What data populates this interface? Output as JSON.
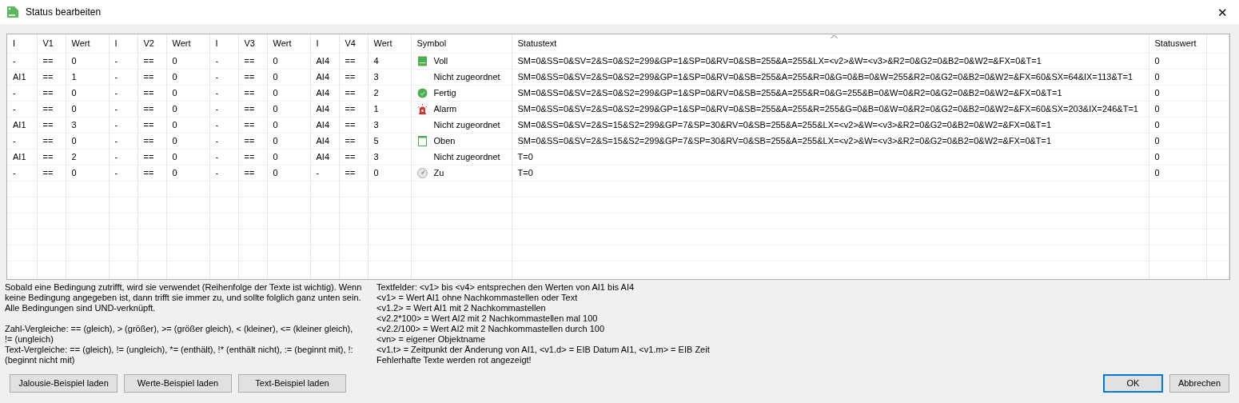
{
  "window": {
    "title": "Status bearbeiten",
    "close": "✕"
  },
  "table": {
    "columns": [
      {
        "label": "I",
        "sorted": false
      },
      {
        "label": "V1",
        "sorted": false
      },
      {
        "label": "Wert",
        "sorted": false
      },
      {
        "label": "I",
        "sorted": false
      },
      {
        "label": "V2",
        "sorted": false
      },
      {
        "label": "Wert",
        "sorted": false
      },
      {
        "label": "I",
        "sorted": false
      },
      {
        "label": "V3",
        "sorted": false
      },
      {
        "label": "Wert",
        "sorted": false
      },
      {
        "label": "I",
        "sorted": false
      },
      {
        "label": "V4",
        "sorted": false
      },
      {
        "label": "Wert",
        "sorted": false
      },
      {
        "label": "Symbol",
        "sorted": false
      },
      {
        "label": "Statustext",
        "sorted": true
      },
      {
        "label": "Statuswert",
        "sorted": false
      }
    ],
    "rows": [
      {
        "cells": [
          "-",
          "==",
          "0",
          "-",
          "==",
          "0",
          "-",
          "==",
          "0",
          "AI4",
          "==",
          "4"
        ],
        "symbol": {
          "kind": "panel-filled",
          "label": "Voll"
        },
        "statustext": "SM=0&SS=0&SV=2&S=0&S2=299&GP=1&SP=0&RV=0&SB=255&A=255&LX=<v2>&W=<v3>&R2=0&G2=0&B2=0&W2=&FX=0&T=1",
        "statuswert": "0"
      },
      {
        "cells": [
          "AI1",
          "==",
          "1",
          "-",
          "==",
          "0",
          "-",
          "==",
          "0",
          "AI4",
          "==",
          "3"
        ],
        "symbol": {
          "kind": "none",
          "label": "Nicht zugeordnet"
        },
        "statustext": "SM=0&SS=0&SV=2&S=0&S2=299&GP=1&SP=0&RV=0&SB=255&A=255&R=0&G=0&B=0&W=255&R2=0&G2=0&B2=0&W2=&FX=60&SX=64&IX=113&T=1",
        "statuswert": "0"
      },
      {
        "cells": [
          "-",
          "==",
          "0",
          "-",
          "==",
          "0",
          "-",
          "==",
          "0",
          "AI4",
          "==",
          "2"
        ],
        "symbol": {
          "kind": "check",
          "label": "Fertig"
        },
        "statustext": "SM=0&SS=0&SV=2&S=0&S2=299&GP=1&SP=0&RV=0&SB=255&A=255&R=0&G=255&B=0&W=0&R2=0&G2=0&B2=0&W2=&FX=0&T=1",
        "statuswert": "0"
      },
      {
        "cells": [
          "-",
          "==",
          "0",
          "-",
          "==",
          "0",
          "-",
          "==",
          "0",
          "AI4",
          "==",
          "1"
        ],
        "symbol": {
          "kind": "alarm",
          "label": "Alarm"
        },
        "statustext": "SM=0&SS=0&SV=2&S=0&S2=299&GP=1&SP=0&RV=0&SB=255&A=255&R=255&G=0&B=0&W=0&R2=0&G2=0&B2=0&W2=&FX=60&SX=203&IX=246&T=1",
        "statuswert": "0"
      },
      {
        "cells": [
          "AI1",
          "==",
          "3",
          "-",
          "==",
          "0",
          "-",
          "==",
          "0",
          "AI4",
          "==",
          "3"
        ],
        "symbol": {
          "kind": "none",
          "label": "Nicht zugeordnet"
        },
        "statustext": "SM=0&SS=0&SV=2&S=15&S2=299&GP=7&SP=30&RV=0&SB=255&A=255&LX=<v2>&W=<v3>&R2=0&G2=0&B2=0&W2=&FX=0&T=1",
        "statuswert": "0"
      },
      {
        "cells": [
          "-",
          "==",
          "0",
          "-",
          "==",
          "0",
          "-",
          "==",
          "0",
          "AI4",
          "==",
          "5"
        ],
        "symbol": {
          "kind": "panel-outline",
          "label": "Oben"
        },
        "statustext": "SM=0&SS=0&SV=2&S=15&S2=299&GP=7&SP=30&RV=0&SB=255&A=255&LX=<v2>&W=<v3>&R2=0&G2=0&B2=0&W2=&FX=0&T=1",
        "statuswert": "0"
      },
      {
        "cells": [
          "AI1",
          "==",
          "2",
          "-",
          "==",
          "0",
          "-",
          "==",
          "0",
          "AI4",
          "==",
          "3"
        ],
        "symbol": {
          "kind": "none",
          "label": "Nicht zugeordnet"
        },
        "statustext": "T=0",
        "statuswert": "0"
      },
      {
        "cells": [
          "-",
          "==",
          "0",
          "-",
          "==",
          "0",
          "-",
          "==",
          "0",
          "-",
          "==",
          "0"
        ],
        "symbol": {
          "kind": "dial",
          "label": "Zu"
        },
        "statustext": "T=0",
        "statuswert": "0"
      }
    ]
  },
  "help_left": [
    "Sobald eine Bedingung zutrifft, wird sie verwendet (Reihenfolge der Texte ist wichtig). Wenn keine Bedingung angegeben ist, dann trifft sie immer zu, und sollte folglich ganz unten sein. Alle Bedingungen sind UND-verknüpft.",
    "Zahl-Vergleiche: == (gleich), > (größer), >= (größer gleich), < (kleiner), <= (kleiner gleich), != (ungleich)",
    "Text-Vergleiche: == (gleich), != (ungleich), *= (enthält), !* (enthält nicht), := (beginnt mit), !: (beginnt nicht mit)"
  ],
  "help_right": [
    "Textfelder: <v1> bis <v4> entsprechen den Werten von AI1 bis AI4",
    "<v1> = Wert AI1 ohne Nachkommastellen oder Text",
    "<v1.2> = Wert AI1 mit 2 Nachkommastellen",
    "<v2.2*100> = Wert AI2 mit 2 Nachkommastellen mal 100",
    "<v2.2/100> = Wert AI2 mit 2 Nachkommastellen durch 100",
    "<vn> = eigener Objektname",
    "<v1.t> = Zeitpunkt der Änderung von AI1, <v1.d> = EIB Datum AI1, <v1.m> = EIB Zeit",
    "Fehlerhafte Texte werden rot angezeigt!"
  ],
  "left_buttons": [
    "Jalousie-Beispiel laden",
    "Werte-Beispiel laden",
    "Text-Beispiel laden"
  ],
  "right_buttons": [
    {
      "label": "OK",
      "default": true
    },
    {
      "label": "Abbrechen",
      "default": false
    }
  ]
}
